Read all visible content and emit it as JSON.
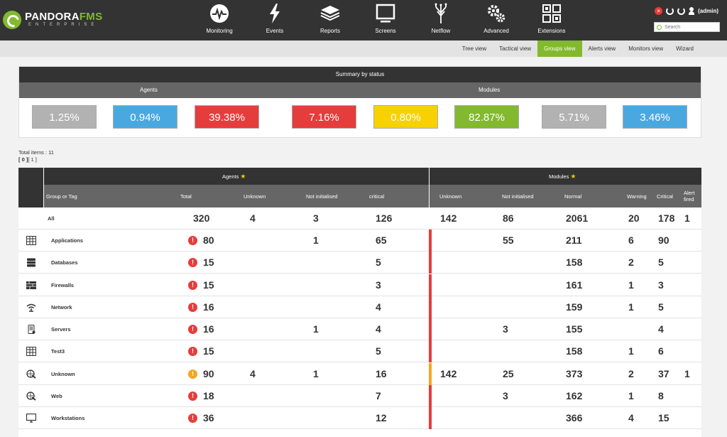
{
  "header": {
    "logo_main": "PANDORA",
    "logo_accent": "FMS",
    "logo_sub": "ENTERPRISE",
    "nav": [
      {
        "label": "Monitoring",
        "icon": "monitoring-icon"
      },
      {
        "label": "Events",
        "icon": "events-icon"
      },
      {
        "label": "Reports",
        "icon": "reports-icon"
      },
      {
        "label": "Screens",
        "icon": "screens-icon"
      },
      {
        "label": "Netflow",
        "icon": "netflow-icon"
      },
      {
        "label": "Advanced",
        "icon": "advanced-icon"
      },
      {
        "label": "Extensions",
        "icon": "extensions-icon"
      }
    ],
    "user": "(admin)",
    "search_placeholder": "Search"
  },
  "subnav": {
    "tabs": [
      "Tree view",
      "Tactical view",
      "Groups view",
      "Alerts view",
      "Monitors view",
      "Wizard"
    ],
    "active": "Groups view"
  },
  "summary": {
    "title": "Summary by status",
    "agents_label": "Agents",
    "modules_label": "Modules",
    "boxes": [
      {
        "value": "1.25%",
        "color": "#b2b2b2"
      },
      {
        "value": "0.94%",
        "color": "#4aa8e0"
      },
      {
        "value": "39.38%",
        "color": "#e63c3c"
      },
      {
        "value": "7.16%",
        "color": "#e63c3c"
      },
      {
        "value": "0.80%",
        "color": "#f7d100"
      },
      {
        "value": "82.87%",
        "color": "#82b92e"
      },
      {
        "value": "5.71%",
        "color": "#b2b2b2"
      },
      {
        "value": "3.46%",
        "color": "#4aa8e0"
      }
    ]
  },
  "totals": {
    "label": "Total items : 11",
    "page_current": "[ 0 ]",
    "page_other": "[ 1 ]"
  },
  "table": {
    "agents_header": "Agents",
    "modules_header": "Modules",
    "columns": [
      "Group or Tag",
      "Total",
      "Unknown",
      "Not initialised",
      "critical",
      "Unknown",
      "Not initialised",
      "Normal",
      "Warning",
      "Critical",
      "Alert fired"
    ],
    "all_row": {
      "name": "All",
      "total": "320",
      "a_unknown": "4",
      "a_notinit": "3",
      "a_critical": "126",
      "m_unknown": "142",
      "m_notinit": "86",
      "m_normal": "2061",
      "m_warning": "20",
      "m_critical": "178",
      "m_alert": "1"
    },
    "rows": [
      {
        "name": "Applications",
        "icon": "applications-icon",
        "status": "critical",
        "total": "80",
        "a_unknown": "",
        "a_notinit": "1",
        "a_critical": "65",
        "m_unknown": "",
        "m_notinit": "55",
        "m_normal": "211",
        "m_warning": "6",
        "m_critical": "90",
        "m_alert": ""
      },
      {
        "name": "Databases",
        "icon": "databases-icon",
        "status": "critical",
        "total": "15",
        "a_unknown": "",
        "a_notinit": "",
        "a_critical": "5",
        "m_unknown": "",
        "m_notinit": "",
        "m_normal": "158",
        "m_warning": "2",
        "m_critical": "5",
        "m_alert": ""
      },
      {
        "name": "Firewalls",
        "icon": "firewalls-icon",
        "status": "critical",
        "total": "15",
        "a_unknown": "",
        "a_notinit": "",
        "a_critical": "3",
        "m_unknown": "",
        "m_notinit": "",
        "m_normal": "161",
        "m_warning": "1",
        "m_critical": "3",
        "m_alert": ""
      },
      {
        "name": "Network",
        "icon": "network-icon",
        "status": "critical",
        "total": "16",
        "a_unknown": "",
        "a_notinit": "",
        "a_critical": "4",
        "m_unknown": "",
        "m_notinit": "",
        "m_normal": "159",
        "m_warning": "1",
        "m_critical": "5",
        "m_alert": ""
      },
      {
        "name": "Servers",
        "icon": "servers-icon",
        "status": "critical",
        "total": "16",
        "a_unknown": "",
        "a_notinit": "1",
        "a_critical": "4",
        "m_unknown": "",
        "m_notinit": "3",
        "m_normal": "155",
        "m_warning": "",
        "m_critical": "4",
        "m_alert": ""
      },
      {
        "name": "Test3",
        "icon": "test3-icon",
        "status": "critical",
        "total": "15",
        "a_unknown": "",
        "a_notinit": "",
        "a_critical": "5",
        "m_unknown": "",
        "m_notinit": "",
        "m_normal": "158",
        "m_warning": "1",
        "m_critical": "6",
        "m_alert": ""
      },
      {
        "name": "Unknown",
        "icon": "unknown-group-icon",
        "status": "warning",
        "total": "90",
        "a_unknown": "4",
        "a_notinit": "1",
        "a_critical": "16",
        "m_unknown": "142",
        "m_notinit": "25",
        "m_normal": "373",
        "m_warning": "2",
        "m_critical": "37",
        "m_alert": "1"
      },
      {
        "name": "Web",
        "icon": "web-icon",
        "status": "critical",
        "total": "18",
        "a_unknown": "",
        "a_notinit": "",
        "a_critical": "7",
        "m_unknown": "",
        "m_notinit": "3",
        "m_normal": "162",
        "m_warning": "1",
        "m_critical": "8",
        "m_alert": ""
      },
      {
        "name": "Workstations",
        "icon": "workstations-icon",
        "status": "critical",
        "total": "36",
        "a_unknown": "",
        "a_notinit": "",
        "a_critical": "12",
        "m_unknown": "",
        "m_notinit": "",
        "m_normal": "366",
        "m_warning": "4",
        "m_critical": "15",
        "m_alert": ""
      }
    ]
  },
  "colors": {
    "accent": "#82b92e",
    "critical": "#e63c3c",
    "warning": "#f5a623"
  }
}
